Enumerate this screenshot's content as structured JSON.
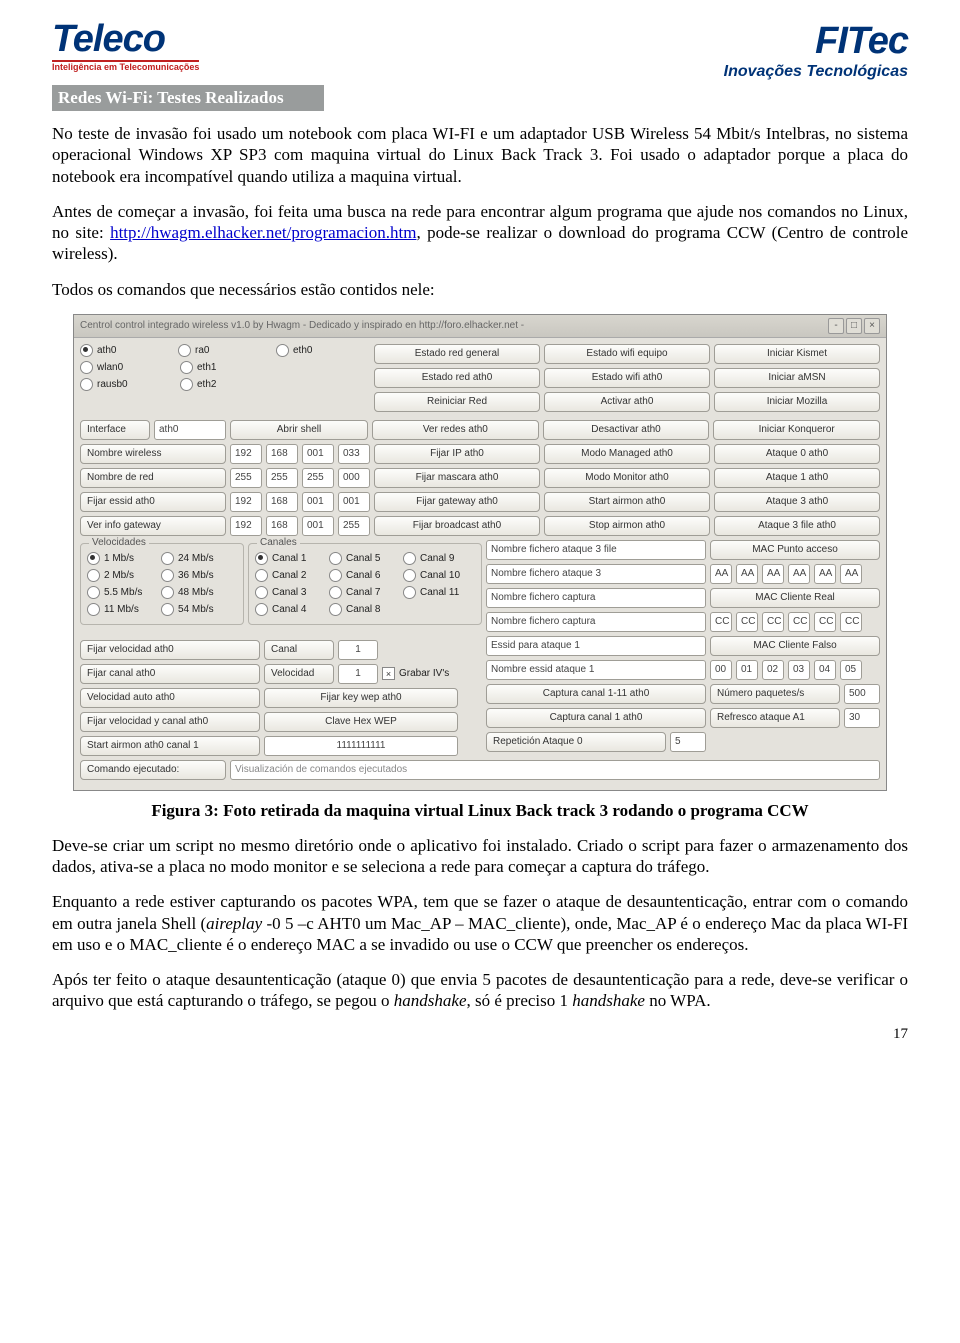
{
  "header": {
    "teleco_main": "Teleco",
    "teleco_sub": "Inteligência em Telecomunicações",
    "fitec_main": "FITec",
    "fitec_sub": "Inovações Tecnológicas"
  },
  "section_title": "Redes Wi-Fi: Testes Realizados",
  "para1": "No teste de invasão foi usado um notebook com placa WI-FI e um adaptador USB Wireless 54 Mbit/s Intelbras, no sistema operacional Windows XP SP3 com maquina virtual do Linux Back Track 3. Foi usado o adaptador porque a placa do notebook era incompatível quando utiliza a maquina virtual.",
  "para2_a": "Antes de começar a invasão, foi feita uma busca na rede para encontrar algum programa que ajude nos comandos no Linux, no site: ",
  "para2_link": "http://hwagm.elhacker.net/programacion.htm",
  "para2_b": ", pode-se realizar o download do programa CCW (Centro de controle wireless).",
  "para3": "Todos os comandos que necessários estão contidos nele:",
  "caption": "Figura 3: Foto retirada da maquina virtual Linux Back track 3 rodando o programa CCW",
  "para4": "Deve-se criar um script no mesmo diretório onde o aplicativo foi instalado. Criado o script para fazer o armazenamento dos dados, ativa-se a placa no modo monitor e se seleciona a rede para começar a captura do tráfego.",
  "para5_a": "Enquanto a rede estiver capturando os pacotes WPA, tem que se fazer o ataque de desauntenticação, entrar com o comando em outra janela Shell (",
  "para5_i": "aireplay",
  "para5_b": " -0 5 –c AHT0 um Mac_AP – MAC_cliente), onde, Mac_AP é o endereço Mac da placa WI-FI em uso e o MAC_cliente é o endereço MAC a se invadido ou use o CCW que preencher os endereços.",
  "para6_a": "Após ter feito o ataque desauntenticação (ataque 0) que envia 5 pacotes de desauntenticação para a rede, deve-se verificar o arquivo que está capturando o tráfego, se pegou o ",
  "para6_i1": "handshake",
  "para6_b": ", só é preciso 1 ",
  "para6_i2": "handshake",
  "para6_c": " no WPA.",
  "pagenum": "17",
  "app": {
    "title": "Centrol control integrado wireless v1.0 by Hwagm - Dedicado y inspirado en http://foro.elhacker.net -",
    "ifaces": [
      "ath0",
      "ra0",
      "eth0",
      "wlan0",
      "eth1",
      "rausb0",
      "eth2"
    ],
    "col3": [
      "Estado red general",
      "Estado red ath0",
      "Reiniciar Red",
      "Ver redes ath0",
      "Fijar IP ath0",
      "Fijar mascara ath0",
      "Fijar gateway ath0",
      "Fijar broadcast ath0"
    ],
    "col4": [
      "Estado wifi equipo",
      "Estado wifi ath0",
      "Activar ath0",
      "Desactivar ath0",
      "Modo Managed ath0",
      "Modo Monitor ath0",
      "Start airmon ath0",
      "Stop airmon ath0"
    ],
    "col5": [
      "Iniciar Kismet",
      "Iniciar aMSN",
      "Iniciar Mozilla",
      "Iniciar Konqueror",
      "Ataque 0 ath0",
      "Ataque 1 ath0",
      "Ataque 3 ath0",
      "Ataque 3 file ath0"
    ],
    "interface_lbl": "Interface",
    "interface_val": "ath0",
    "abrir_shell": "Abrir shell",
    "left_btns": [
      "Nombre wireless",
      "Nombre de red",
      "Fijar essid ath0",
      "Ver info gateway"
    ],
    "oct": [
      [
        "192",
        "168",
        "001",
        "033"
      ],
      [
        "255",
        "255",
        "255",
        "000"
      ],
      [
        "192",
        "168",
        "001",
        "001"
      ],
      [
        "192",
        "168",
        "001",
        "255"
      ]
    ],
    "vel_title": "Velocidades",
    "vel": [
      "1 Mb/s",
      "24 Mb/s",
      "2 Mb/s",
      "36 Mb/s",
      "5.5 Mb/s",
      "48 Mb/s",
      "11 Mb/s",
      "54 Mb/s"
    ],
    "can_title": "Canales",
    "can": [
      "Canal 1",
      "Canal 5",
      "Canal 9",
      "Canal 2",
      "Canal 6",
      "Canal 10",
      "Canal 3",
      "Canal 7",
      "Canal 11",
      "Canal 4",
      "Canal 8"
    ],
    "left_lower": [
      "Fijar velocidad ath0",
      "Fijar canal ath0",
      "Velocidad auto ath0",
      "Fijar velocidad y canal ath0",
      "Start airmon ath0 canal 1"
    ],
    "canal_lbl": "Canal",
    "canal_val": "1",
    "velocidad_lbl": "Velocidad",
    "velocidad_val": "1",
    "grabar": "Grabar IV's",
    "fijar_wep": "Fijar key wep ath0",
    "clave_hex": "Clave Hex WEP",
    "clave_val": "1111111111",
    "mid_inputs": [
      "Nombre fichero ataque 3 file",
      "Nombre fichero ataque 3",
      "Nombre fichero captura",
      "Nombre fichero captura",
      "Essid para ataque 1",
      "Nombre essid ataque 1"
    ],
    "mid_btns": [
      "Captura canal 1-11 ath0",
      "Captura canal 1 ath0"
    ],
    "rep_lbl": "Repetición Ataque 0",
    "rep_val": "5",
    "mac_ap": "MAC Punto acceso",
    "mac_cli_real": "MAC Cliente Real",
    "mac_cli_falso": "MAC Cliente Falso",
    "mac1": [
      "AA",
      "AA",
      "AA",
      "AA",
      "AA",
      "AA"
    ],
    "mac2": [
      "CC",
      "CC",
      "CC",
      "CC",
      "CC",
      "CC"
    ],
    "mac3": [
      "00",
      "01",
      "02",
      "03",
      "04",
      "05"
    ],
    "num_paq": "Número paquetes/s",
    "num_paq_v": "500",
    "refresco": "Refresco ataque A1",
    "refresco_v": "30",
    "cmd_lbl": "Comando ejecutado:",
    "cmd_val": "Visualización de comandos ejecutados"
  }
}
